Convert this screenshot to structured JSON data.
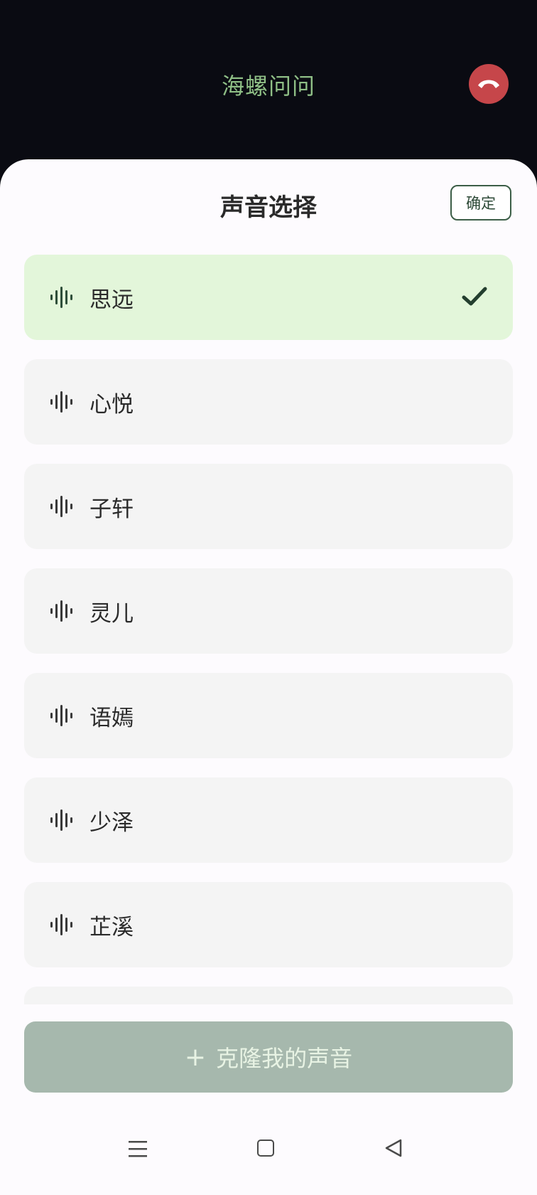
{
  "header": {
    "app_title": "海螺问问",
    "hangup_icon": "phone-hangup-icon",
    "hangup_color": "#c6464a"
  },
  "sheet": {
    "title": "声音选择",
    "confirm_label": "确定"
  },
  "voices": [
    {
      "label": "思远",
      "selected": true
    },
    {
      "label": "心悦",
      "selected": false
    },
    {
      "label": "子轩",
      "selected": false
    },
    {
      "label": "灵儿",
      "selected": false
    },
    {
      "label": "语嫣",
      "selected": false
    },
    {
      "label": "少泽",
      "selected": false
    },
    {
      "label": "芷溪",
      "selected": false
    }
  ],
  "clone": {
    "plus": "+",
    "label": "克隆我的声音"
  },
  "colors": {
    "selected_bg": "#e3f6da",
    "item_bg": "#f4f4f4",
    "accent": "#3c5e47",
    "clone_bg": "#a6b8ad"
  }
}
